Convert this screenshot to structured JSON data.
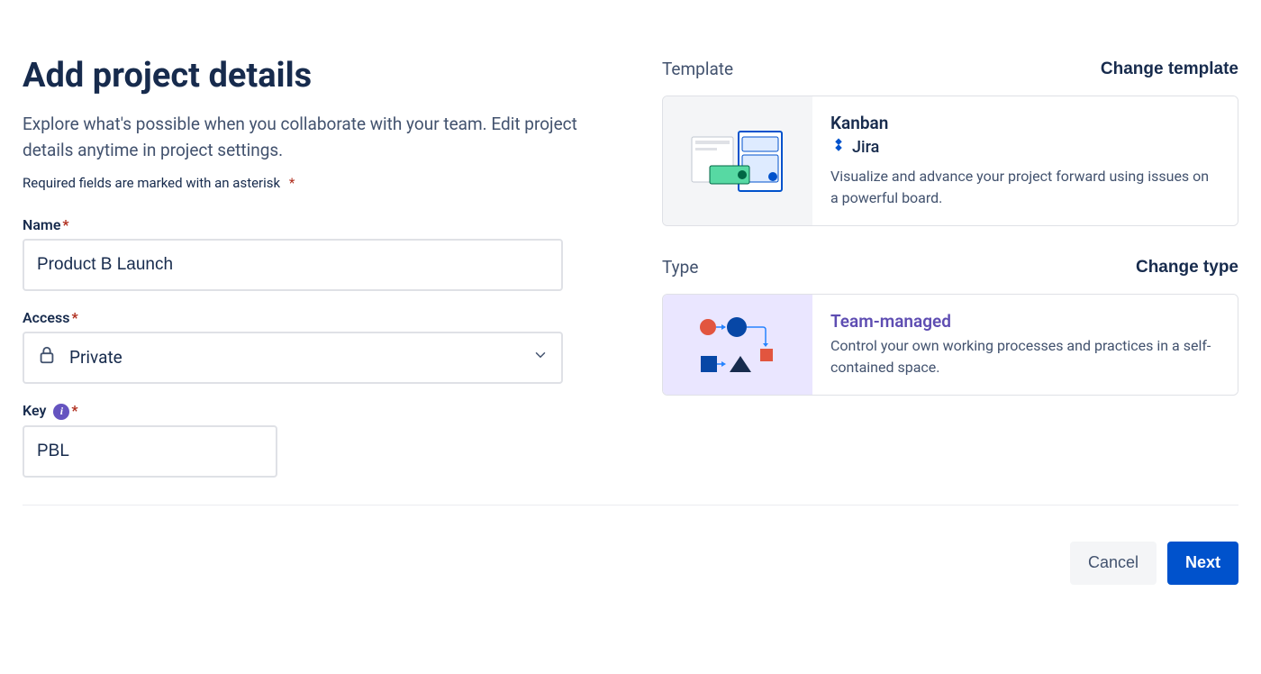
{
  "header": {
    "title": "Add project details",
    "subtitle": "Explore what's possible when you collaborate with your team. Edit project details anytime in project settings.",
    "required_note": "Required fields are marked with an asterisk",
    "asterisk": "*"
  },
  "fields": {
    "name": {
      "label": "Name",
      "value": "Product B Launch"
    },
    "access": {
      "label": "Access",
      "selected": "Private"
    },
    "key": {
      "label": "Key",
      "value": "PBL"
    }
  },
  "template": {
    "section_label": "Template",
    "action": "Change template",
    "card": {
      "title": "Kanban",
      "product": "Jira",
      "description": "Visualize and advance your project forward using issues on a powerful board."
    }
  },
  "type": {
    "section_label": "Type",
    "action": "Change type",
    "card": {
      "title": "Team-managed",
      "description": "Control your own working processes and practices in a self-contained space."
    }
  },
  "footer": {
    "cancel": "Cancel",
    "next": "Next"
  }
}
